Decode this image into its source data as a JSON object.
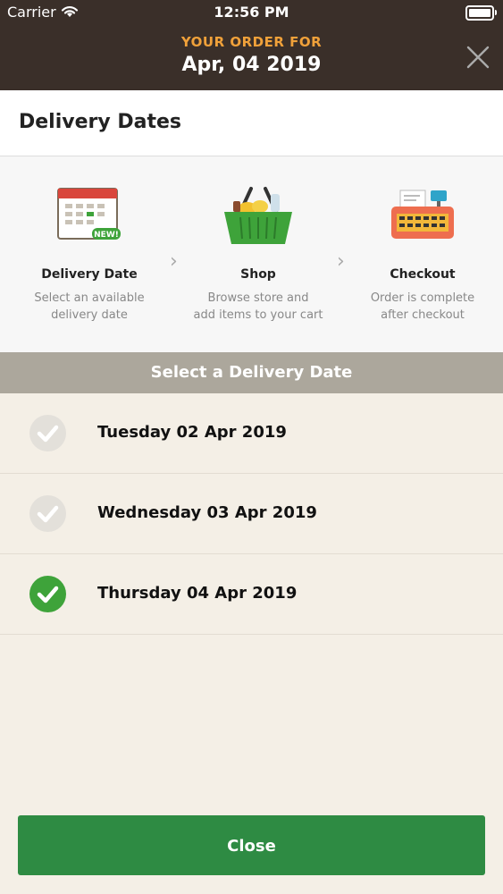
{
  "status_bar": {
    "carrier": "Carrier",
    "time": "12:56 PM"
  },
  "header": {
    "order_label": "YOUR ORDER FOR",
    "order_date": "Apr, 04 2019"
  },
  "page": {
    "title": "Delivery Dates"
  },
  "steps": [
    {
      "icon": "calendar-icon",
      "badge": "NEW!",
      "title": "Delivery Date",
      "desc_line1": "Select an available",
      "desc_line2": "delivery date"
    },
    {
      "icon": "basket-icon",
      "title": "Shop",
      "desc_line1": "Browse store and",
      "desc_line2": "add items to your cart"
    },
    {
      "icon": "cash-register-icon",
      "title": "Checkout",
      "desc_line1": "Order is complete",
      "desc_line2": "after checkout"
    }
  ],
  "section": {
    "title": "Select a Delivery Date"
  },
  "dates": [
    {
      "label": "Tuesday 02 Apr 2019",
      "selected": false
    },
    {
      "label": "Wednesday 03 Apr 2019",
      "selected": false
    },
    {
      "label": "Thursday 04 Apr 2019",
      "selected": true
    }
  ],
  "footer": {
    "close_label": "Close"
  },
  "colors": {
    "header_bg": "#3a2f29",
    "accent_orange": "#f0a13a",
    "primary_green": "#2e8b43",
    "check_green": "#3ea33a"
  }
}
